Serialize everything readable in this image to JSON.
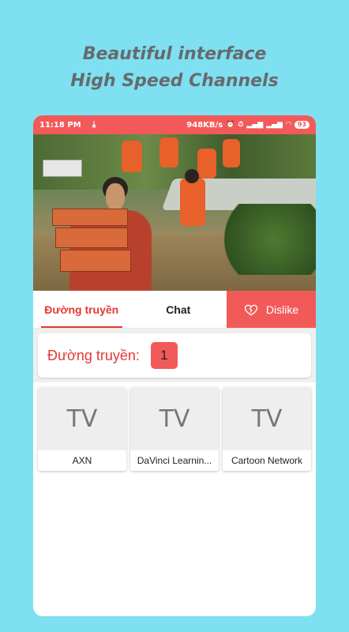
{
  "headline": {
    "line1": "Beautiful interface",
    "line2": "High Speed Channels"
  },
  "status_bar": {
    "time": "11:18 PM",
    "network_speed": "948KB/s",
    "battery": "93"
  },
  "tabs": [
    {
      "label": "Đường truyền",
      "active": true
    },
    {
      "label": "Chat",
      "active": false
    }
  ],
  "dislike_button": {
    "label": "Dislike",
    "icon": "broken-heart-icon"
  },
  "server": {
    "label": "Đường truyền:",
    "number": "1"
  },
  "channels": [
    {
      "thumb": "TV",
      "name": "AXN"
    },
    {
      "thumb": "TV",
      "name": "DaVinci Learnin..."
    },
    {
      "thumb": "TV",
      "name": "Cartoon Network"
    }
  ],
  "colors": {
    "background": "#7ee0f0",
    "accent": "#f25a5a",
    "active_tab": "#e53935"
  }
}
